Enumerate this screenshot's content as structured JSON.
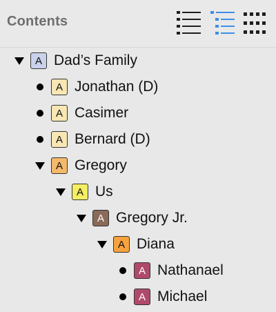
{
  "header": {
    "title": "Contents",
    "views": [
      {
        "name": "list-view",
        "selected": false
      },
      {
        "name": "outline-view",
        "selected": true
      },
      {
        "name": "grid-view",
        "selected": false
      }
    ]
  },
  "tree": [
    {
      "label": "Dad’s Family",
      "icon_letter": "A",
      "color": "#c9d2ea",
      "control": "disclosure-open",
      "depth": 0
    },
    {
      "label": "Jonathan (D)",
      "icon_letter": "A",
      "color": "#f8e7b4",
      "control": "bullet",
      "depth": 1
    },
    {
      "label": "Casimer",
      "icon_letter": "A",
      "color": "#f8e7b4",
      "control": "bullet",
      "depth": 1
    },
    {
      "label": "Bernard (D)",
      "icon_letter": "A",
      "color": "#f8e7b4",
      "control": "bullet",
      "depth": 1
    },
    {
      "label": "Gregory",
      "icon_letter": "A",
      "color": "#f4b96a",
      "control": "disclosure-open",
      "depth": 1
    },
    {
      "label": "Us",
      "icon_letter": "A",
      "color": "#f3ee62",
      "control": "disclosure-open",
      "depth": 2
    },
    {
      "label": "Gregory Jr.",
      "icon_letter": "A",
      "color": "#8a6a58",
      "control": "disclosure-open",
      "depth": 3
    },
    {
      "label": "Diana",
      "icon_letter": "A",
      "color": "#f7a23e",
      "control": "disclosure-open",
      "depth": 4
    },
    {
      "label": "Nathanael",
      "icon_letter": "A",
      "color": "#b04a6a",
      "control": "bullet",
      "depth": 5
    },
    {
      "label": "Michael",
      "icon_letter": "A",
      "color": "#b04a6a",
      "control": "bullet",
      "depth": 5
    }
  ],
  "colors": {
    "accent": "#3d8ee6",
    "icon_dark": "#1e1e1e"
  }
}
